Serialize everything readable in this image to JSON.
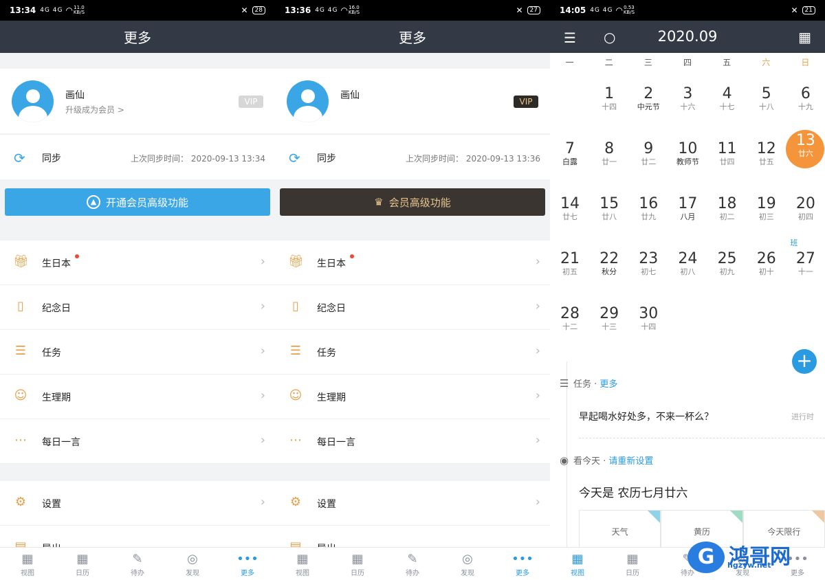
{
  "panel1": {
    "status": {
      "time": "13:34",
      "signal": "4G 4G",
      "speed": "11.0 KB/S",
      "battery": "28"
    },
    "title": "更多",
    "profile": {
      "name": "画仙",
      "sub": "升级成为会员 >",
      "vip": "VIP"
    },
    "sync": {
      "label": "同步",
      "time": "上次同步时间：  2020-09-13 13:34"
    },
    "big_button": "开通会员高级功能"
  },
  "panel2": {
    "status": {
      "time": "13:36",
      "signal": "4G 4G",
      "speed": "16.0 KB/S",
      "battery": "27"
    },
    "title": "更多",
    "profile": {
      "name": "画仙",
      "vip": "VIP"
    },
    "sync": {
      "label": "同步",
      "time": "上次同步时间：  2020-09-13 13:36"
    },
    "big_button": "会员高级功能"
  },
  "menu": [
    {
      "label": "生日本",
      "icon": "gift-icon",
      "dot": true
    },
    {
      "label": "纪念日",
      "icon": "book-icon"
    },
    {
      "label": "任务",
      "icon": "task-icon"
    },
    {
      "label": "生理期",
      "icon": "female-icon"
    },
    {
      "label": "每日一言",
      "icon": "quote-icon"
    }
  ],
  "menu2": [
    {
      "label": "设置",
      "icon": "gear-icon"
    },
    {
      "label": "导出",
      "icon": "export-icon"
    }
  ],
  "tabs": [
    "视图",
    "日历",
    "待办",
    "发现",
    "更多"
  ],
  "panel3": {
    "status": {
      "time": "14:05",
      "signal": "4G 4G",
      "speed": "0.53 KB/S",
      "battery": "21"
    },
    "month": "2020.09",
    "weekdays": [
      "一",
      "二",
      "三",
      "四",
      "五",
      "六",
      "日"
    ],
    "days": [
      {
        "d": "1",
        "l": "十四"
      },
      {
        "d": "2",
        "l": "中元节",
        "fest": true
      },
      {
        "d": "3",
        "l": "十六"
      },
      {
        "d": "4",
        "l": "十七"
      },
      {
        "d": "5",
        "l": "十八"
      },
      {
        "d": "6",
        "l": "十九"
      },
      {
        "d": "7",
        "l": "白露",
        "fest": true
      },
      {
        "d": "8",
        "l": "廿一"
      },
      {
        "d": "9",
        "l": "廿二"
      },
      {
        "d": "10",
        "l": "教师节",
        "fest": true
      },
      {
        "d": "11",
        "l": "廿四"
      },
      {
        "d": "12",
        "l": "廿五"
      },
      {
        "d": "13",
        "l": "廿六",
        "today": true
      },
      {
        "d": "14",
        "l": "廿七"
      },
      {
        "d": "15",
        "l": "廿八"
      },
      {
        "d": "16",
        "l": "廿九"
      },
      {
        "d": "17",
        "l": "八月",
        "fest": true
      },
      {
        "d": "18",
        "l": "初二"
      },
      {
        "d": "19",
        "l": "初三"
      },
      {
        "d": "20",
        "l": "初四"
      },
      {
        "d": "21",
        "l": "初五"
      },
      {
        "d": "22",
        "l": "秋分",
        "fest": true
      },
      {
        "d": "23",
        "l": "初七"
      },
      {
        "d": "24",
        "l": "初八"
      },
      {
        "d": "25",
        "l": "初九"
      },
      {
        "d": "26",
        "l": "初十"
      },
      {
        "d": "27",
        "l": "十一",
        "ban": "班"
      },
      {
        "d": "28",
        "l": "十二"
      },
      {
        "d": "29",
        "l": "十三"
      },
      {
        "d": "30",
        "l": "十四"
      }
    ],
    "task_section": "任务 · ",
    "task_more": "更多",
    "task_text": "早起喝水好处多，不来一杯么？",
    "task_status": "进行时",
    "today_section": "看今天 · ",
    "today_reset": "请重新设置",
    "today_text": "今天是 农历七月廿六",
    "cards": [
      "天气",
      "黄历",
      "今天限行"
    ],
    "watermark": {
      "text": "鸿哥网",
      "url": "hgzyw.net"
    }
  }
}
